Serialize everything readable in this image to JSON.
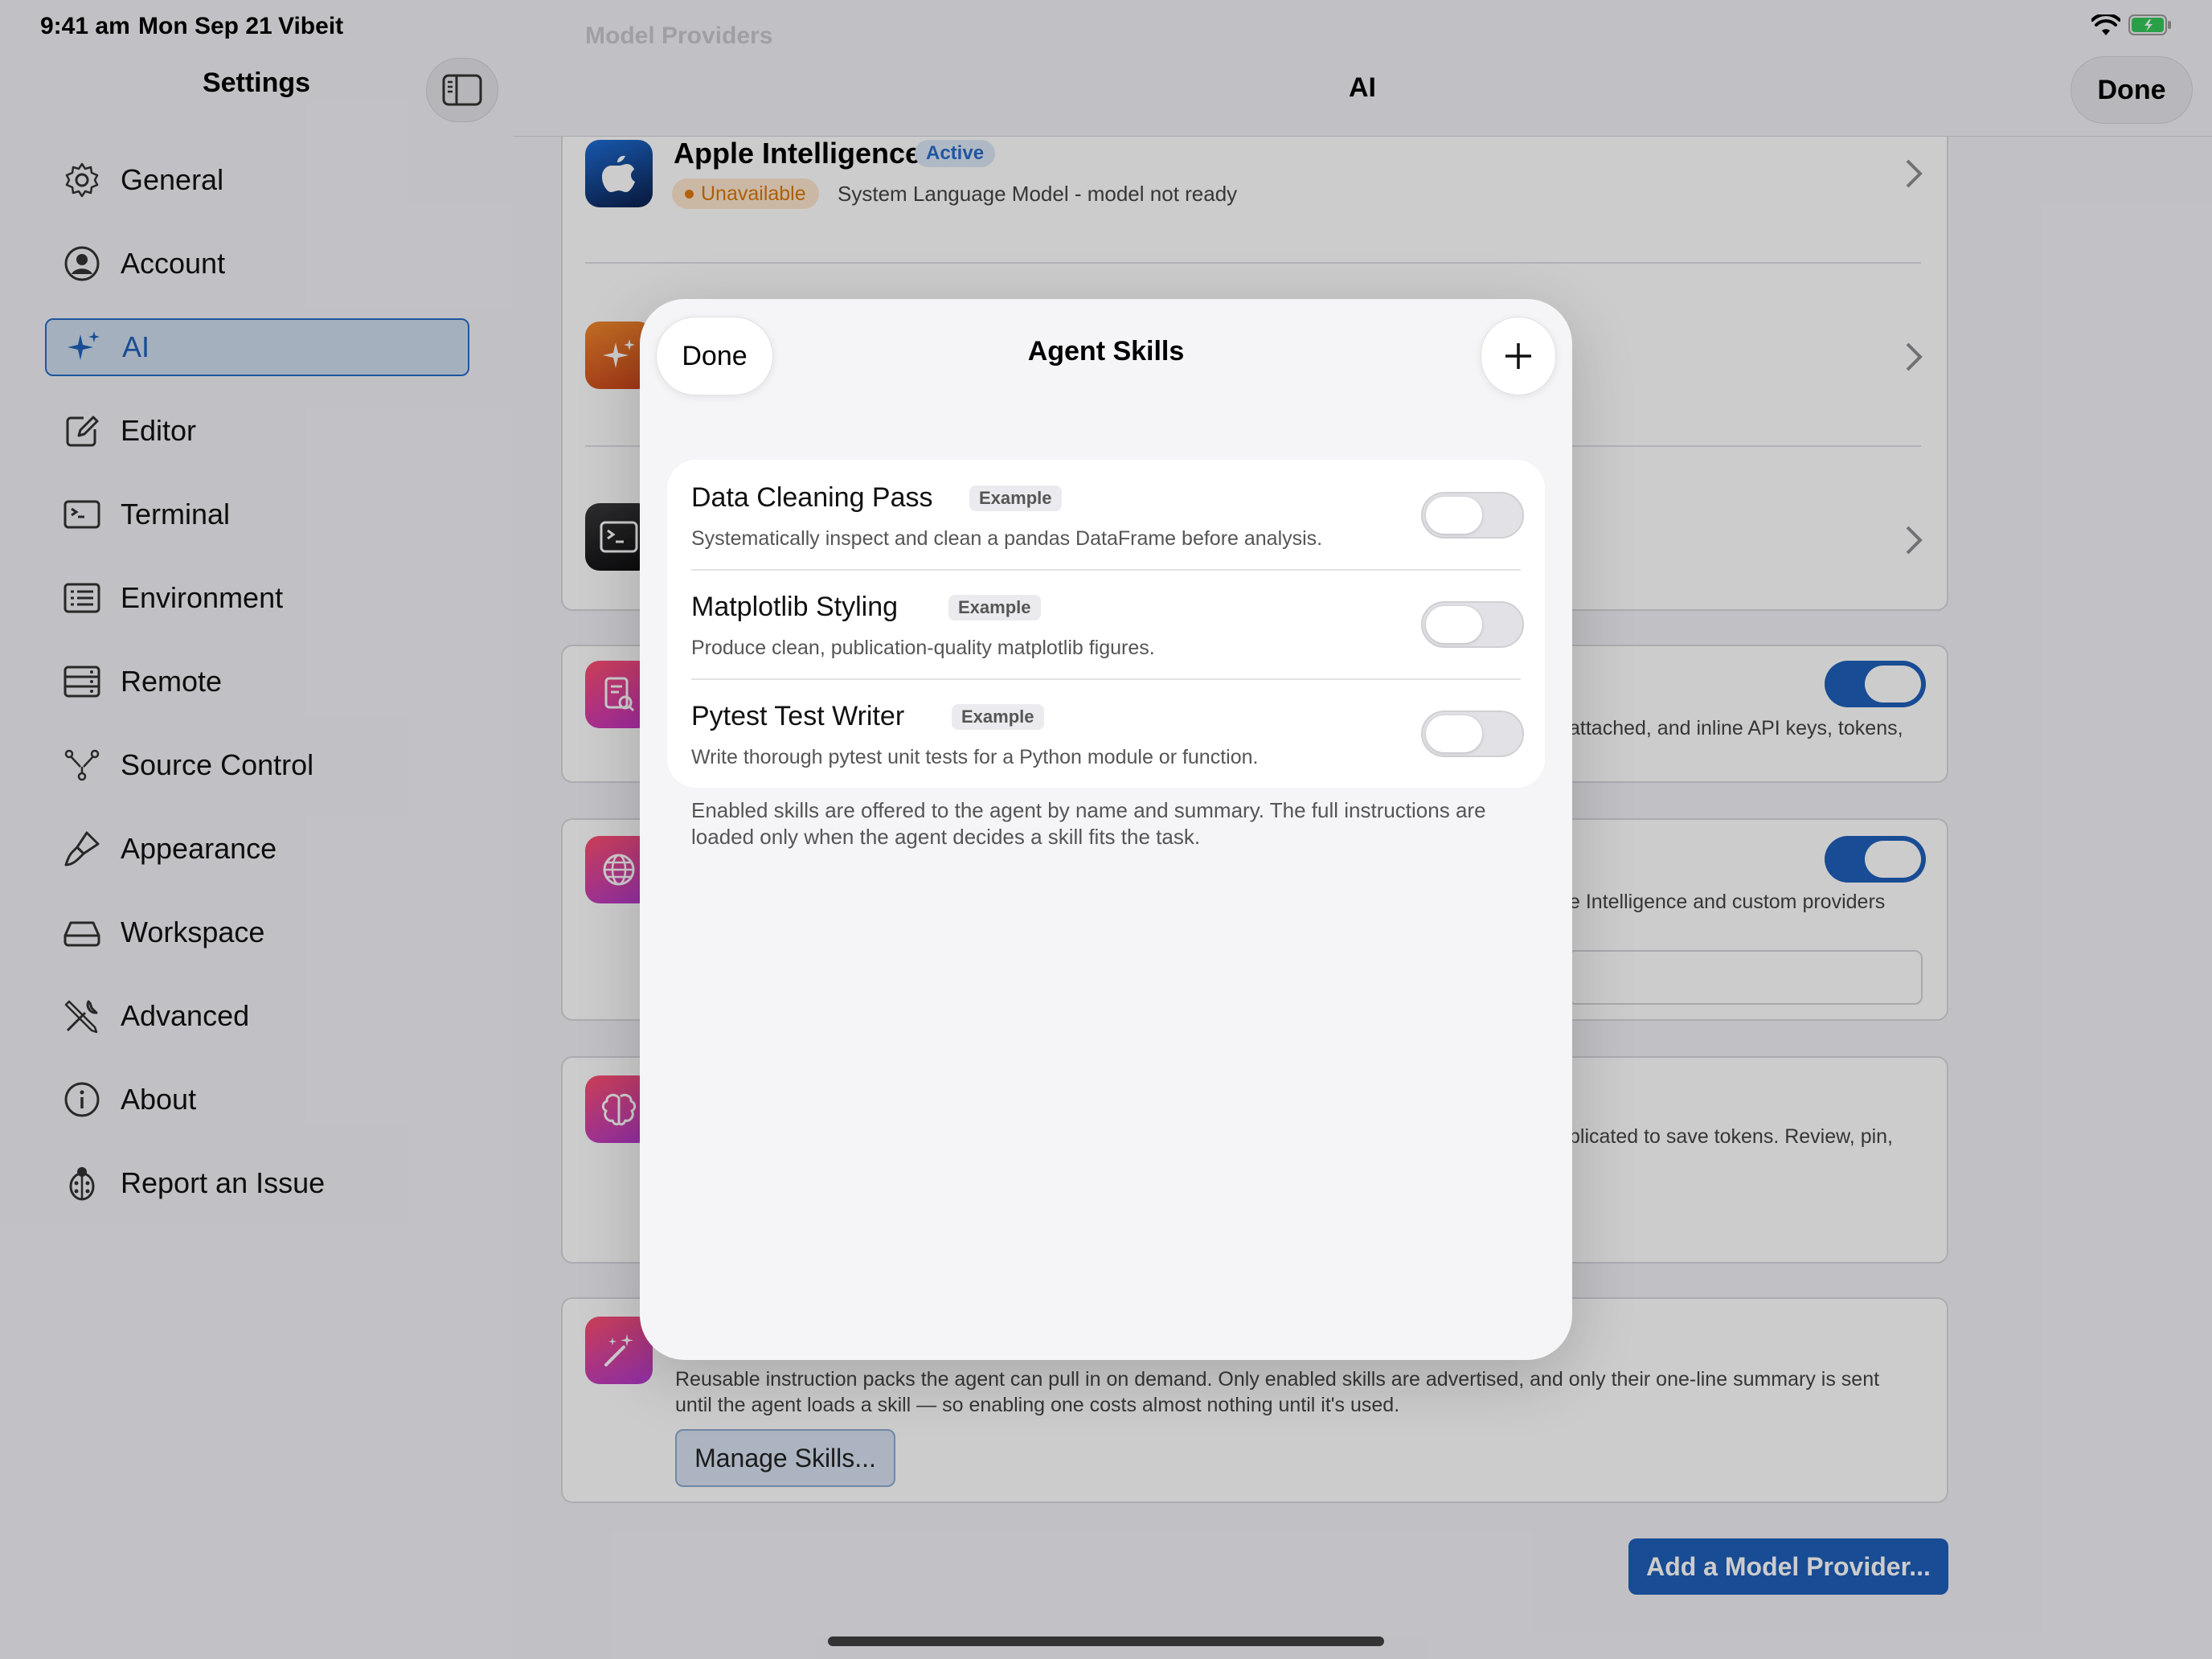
{
  "status_bar": {
    "time": "9:41 am",
    "date": "Mon Sep 21",
    "app": "Vibeit",
    "battery_color": "#34c759"
  },
  "sidebar": {
    "title": "Settings",
    "items": [
      {
        "label": "General",
        "icon": "gear-icon"
      },
      {
        "label": "Account",
        "icon": "person-circle-icon"
      },
      {
        "label": "AI",
        "icon": "sparkles-icon",
        "selected": true
      },
      {
        "label": "Editor",
        "icon": "pencil-square-icon"
      },
      {
        "label": "Terminal",
        "icon": "terminal-icon"
      },
      {
        "label": "Environment",
        "icon": "list-rectangle-icon"
      },
      {
        "label": "Remote",
        "icon": "server-rack-icon"
      },
      {
        "label": "Source Control",
        "icon": "branch-icon"
      },
      {
        "label": "Appearance",
        "icon": "paintbrush-icon"
      },
      {
        "label": "Workspace",
        "icon": "drive-icon"
      },
      {
        "label": "Advanced",
        "icon": "wrench-screwdriver-icon"
      },
      {
        "label": "About",
        "icon": "info-circle-icon"
      },
      {
        "label": "Report an Issue",
        "icon": "ladybug-icon"
      }
    ]
  },
  "header": {
    "title": "AI",
    "done_label": "Done",
    "ghost_title": "Model Providers"
  },
  "providers": {
    "apple": {
      "name": "Apple Intelligence",
      "active_badge": "Active",
      "status_badge": "Unavailable",
      "description": "System Language Model - model not ready"
    }
  },
  "background_text": {
    "privacy_snippet": "attached, and inline API keys, tokens,",
    "web_snippet": "e Intelligence and custom providers",
    "memory_snippet": "plicated to save tokens. Review, pin,",
    "skills_description": "Reusable instruction packs the agent can pull in on demand. Only enabled skills are advertised, and only their one-line summary is sent until the agent loads a skill — so enabling one costs almost nothing until it's used.",
    "manage_skills_label": "Manage Skills...",
    "add_provider_label": "Add a Model Provider..."
  },
  "colors": {
    "accent": "#1f5fba",
    "warning": "#d97706"
  },
  "modal": {
    "done_label": "Done",
    "title": "Agent Skills",
    "add_icon": "plus-icon",
    "skills": [
      {
        "name": "Data Cleaning Pass",
        "badge": "Example",
        "description": "Systematically inspect and clean a pandas DataFrame before analysis.",
        "enabled": false
      },
      {
        "name": "Matplotlib Styling",
        "badge": "Example",
        "description": "Produce clean, publication-quality matplotlib figures.",
        "enabled": false
      },
      {
        "name": "Pytest Test Writer",
        "badge": "Example",
        "description": "Write thorough pytest unit tests for a Python module or function.",
        "enabled": false
      }
    ],
    "footer": "Enabled skills are offered to the agent by name and summary. The full instructions are loaded only when the agent decides a skill fits the task."
  }
}
